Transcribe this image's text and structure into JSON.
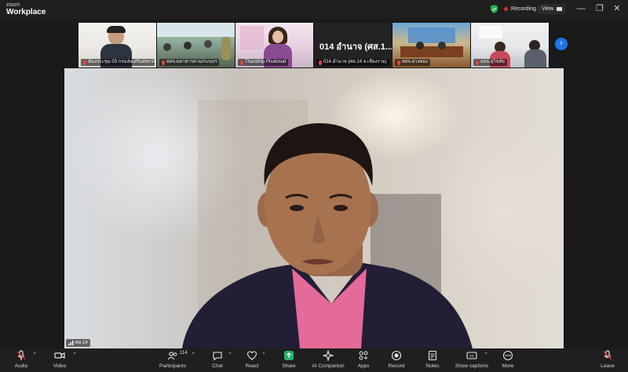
{
  "app": {
    "brand_top": "zoom",
    "brand_main": "Workplace"
  },
  "titlebar": {
    "recording_label": "Recording",
    "view_label": "View"
  },
  "thumbnails": [
    {
      "name": "ห้องประชุม 03 กรมส่งเสริมสหกรณ์",
      "muted": true
    },
    {
      "name": "สสจ.มหาสารคาม/ระบบฯ",
      "muted": true
    },
    {
      "name": "Tharathip Phukmod",
      "muted": true
    },
    {
      "name": "014 อำนาจ (ศส.14 จ.เชียงราย)",
      "big_text": "014 อำนาจ (ศส.1...",
      "muted": true
    },
    {
      "name": "สสจ.อ่างทอง",
      "muted": true
    },
    {
      "name": "สสจ.สุโขทัย",
      "muted": true
    }
  ],
  "speaker": {
    "name": "ศส.14"
  },
  "toolbar": {
    "audio": "Audio",
    "video": "Video",
    "participants": "Participants",
    "participants_count": "114",
    "chat": "Chat",
    "react": "React",
    "share": "Share",
    "ai_companion": "AI Companion",
    "apps": "Apps",
    "record": "Record",
    "notes": "Notes",
    "captions": "Show captions",
    "more": "More",
    "leave": "Leave"
  },
  "colors": {
    "accent": "#1e74e8",
    "share_green": "#23b36b",
    "danger": "#e02828",
    "shield_green": "#2bb14b"
  }
}
